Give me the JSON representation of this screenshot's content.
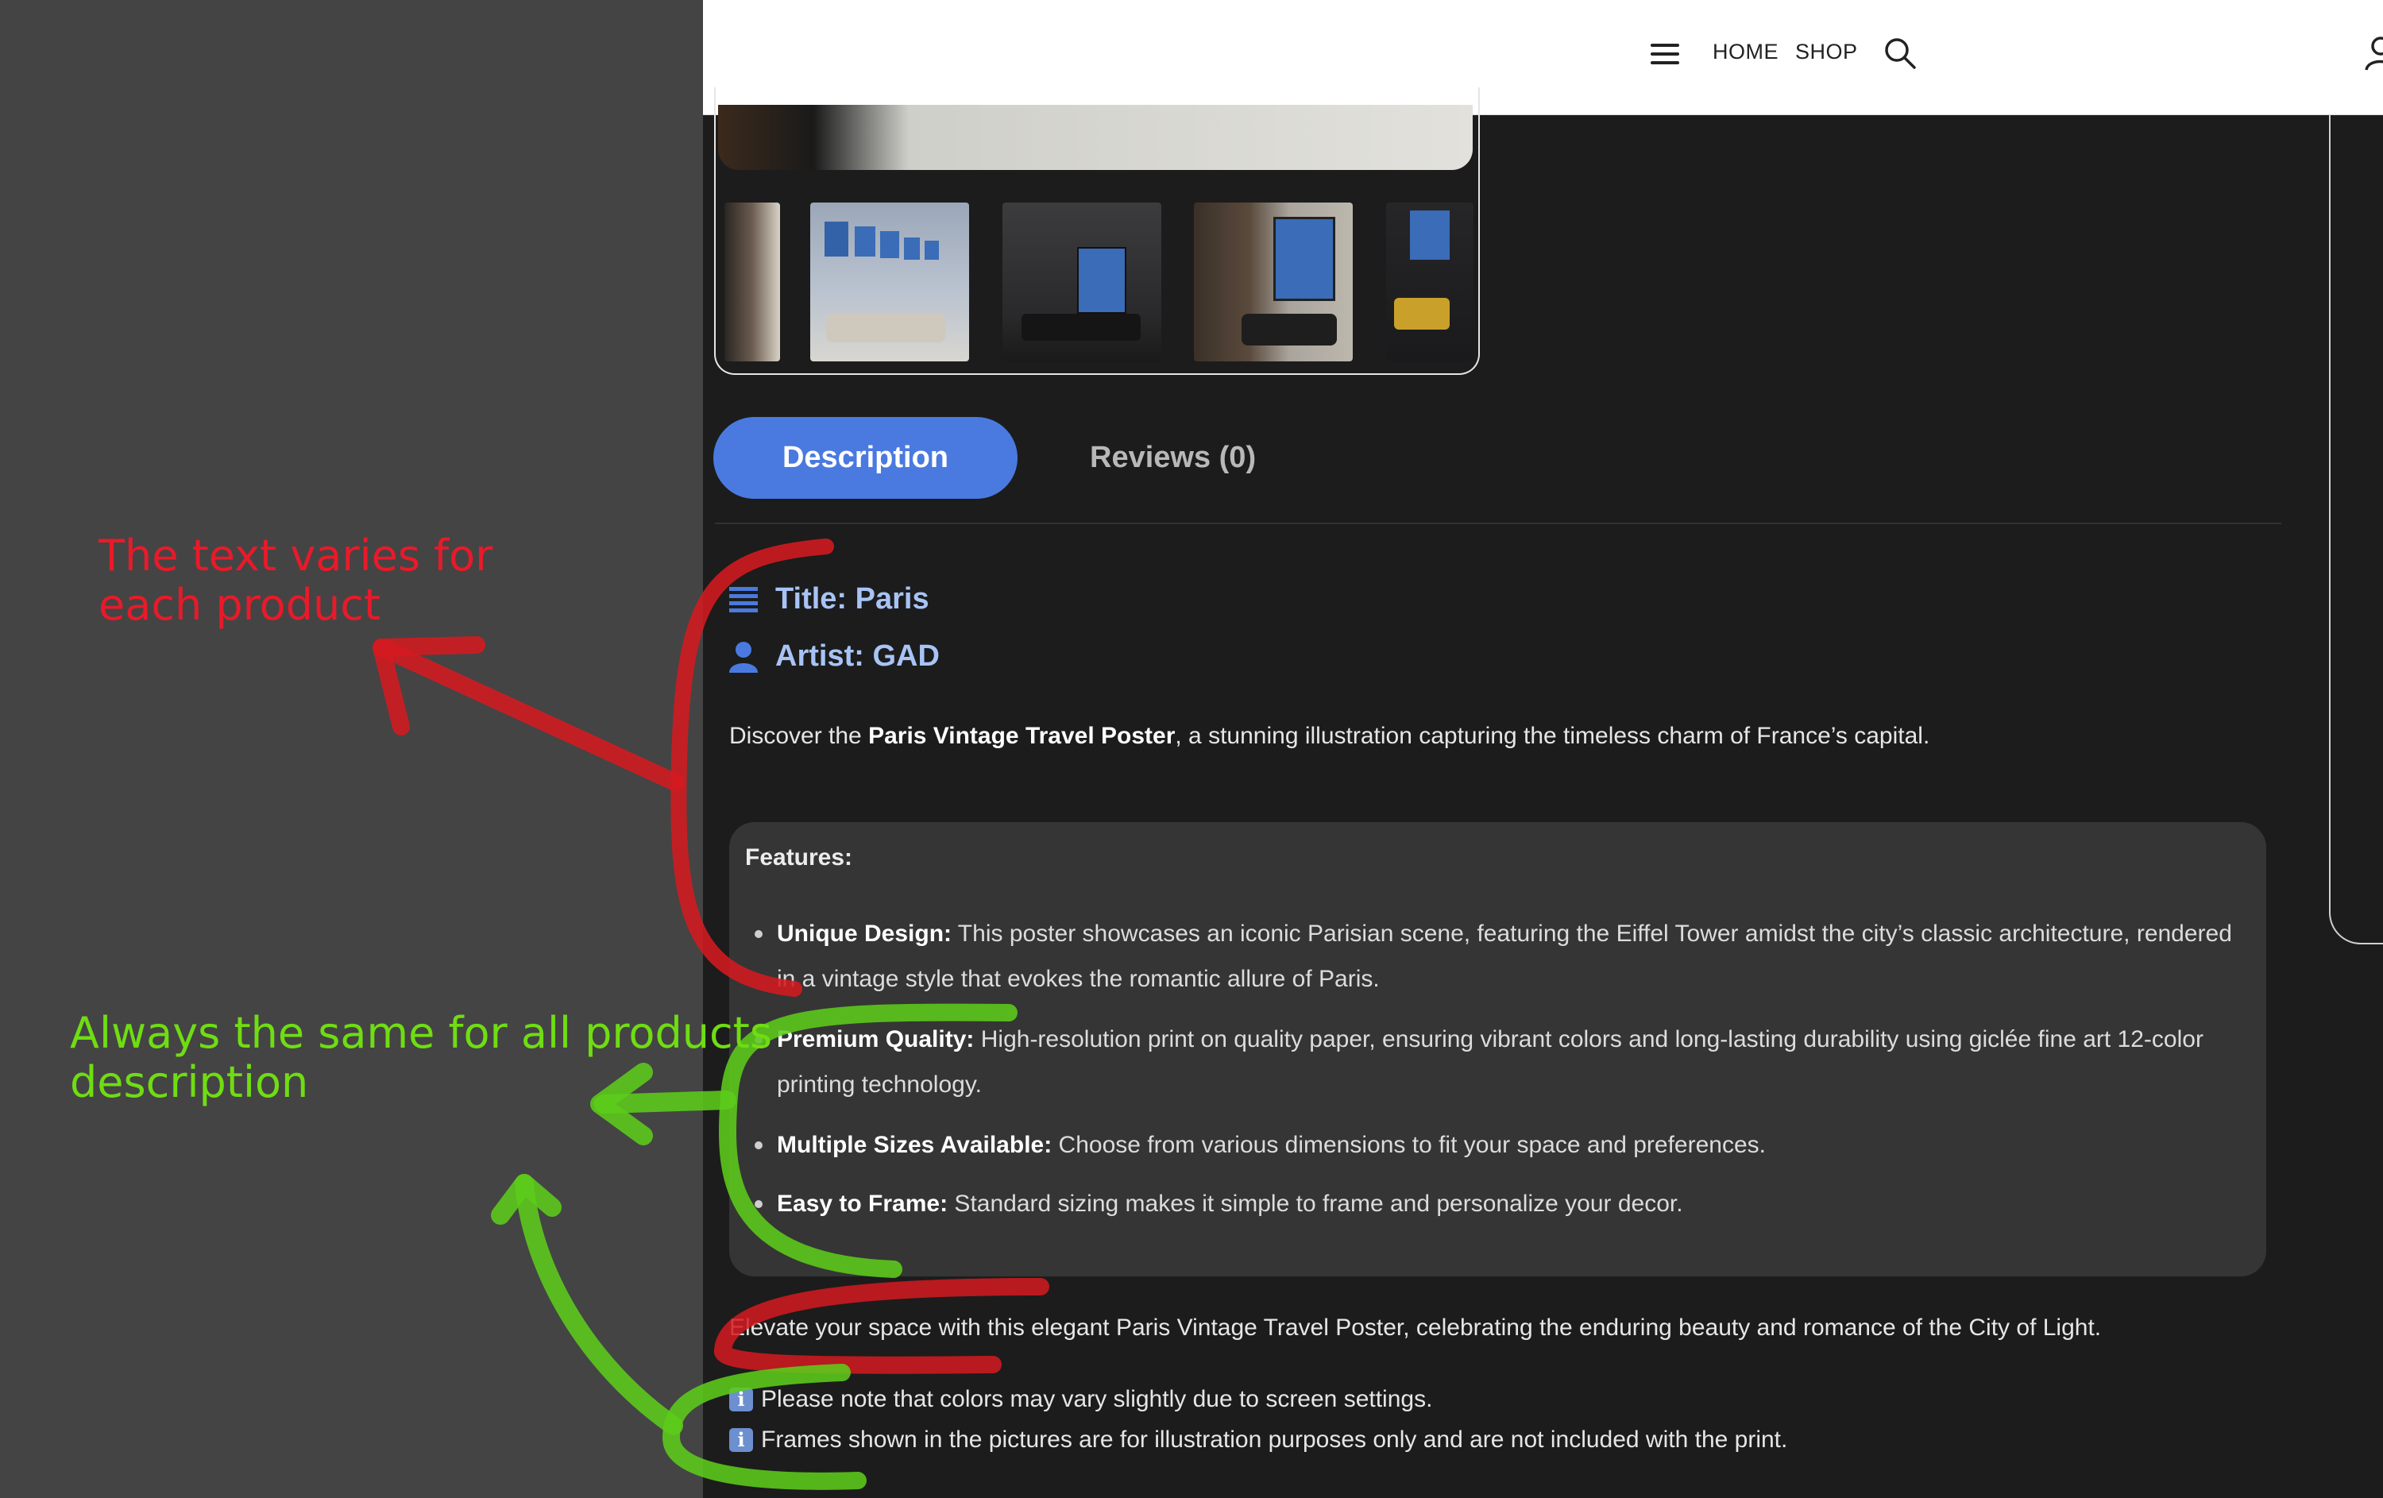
{
  "nav": {
    "home_label": "HOME",
    "shop_label": "SHOP",
    "icons": [
      "menu-icon",
      "search-icon",
      "user-icon"
    ]
  },
  "gallery": {
    "thumbnails": [
      "thumbnail-1",
      "thumbnail-2",
      "thumbnail-3",
      "thumbnail-4",
      "thumbnail-5"
    ]
  },
  "tabs": {
    "description": "Description",
    "reviews": "Reviews (0)"
  },
  "product": {
    "title_line": "Title: Paris",
    "artist_line": "Artist: GAD",
    "intro_prefix": "Discover the ",
    "intro_bold": "Paris Vintage Travel Poster",
    "intro_suffix": ", a stunning illustration capturing the timeless charm of France’s capital."
  },
  "features": {
    "heading": "Features:",
    "items": [
      {
        "label": "Unique Design:",
        "text": " This poster showcases an iconic Parisian scene, featuring the Eiffel Tower amidst the city’s classic architecture, rendered in a vintage style that evokes the romantic allure of Paris."
      },
      {
        "label": "Premium Quality:",
        "text": " High-resolution print on quality paper, ensuring vibrant colors and long-lasting durability using giclée fine art 12-color printing technology."
      },
      {
        "label": "Multiple Sizes Available:",
        "text": " Choose from various dimensions to fit your space and preferences."
      },
      {
        "label": "Easy to Frame:",
        "text": " Standard sizing makes it simple to frame and personalize your decor."
      }
    ]
  },
  "closing": "Elevate your space with this elegant Paris Vintage Travel Poster, celebrating the enduring beauty and romance of the City of Light.",
  "notes": {
    "icon": "ℹ️",
    "line1": "Please note that colors may vary slightly due to screen settings.",
    "line2": "Frames shown in the pictures are for illustration purposes only and are not included with the print."
  },
  "annotations": {
    "red_line1": "The text varies for",
    "red_line2": "each product",
    "green_line1": "Always the same for all products",
    "green_line2": "description"
  },
  "colors": {
    "accent": "#4a7ae0",
    "annotation_red": "#e81a2a",
    "annotation_green": "#6fdd12",
    "page_bg": "#1c1c1c"
  }
}
